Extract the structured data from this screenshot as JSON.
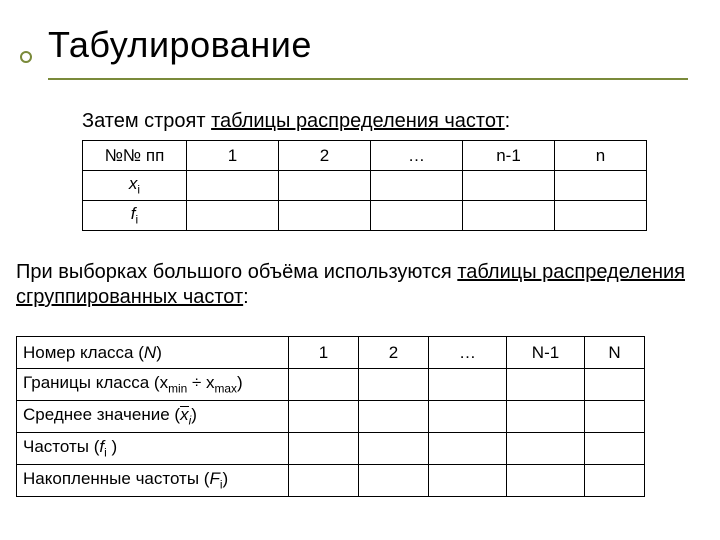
{
  "title": "Табулирование",
  "intro_prefix": "Затем строят ",
  "intro_link": "таблицы распределения частот",
  "intro_suffix": ":",
  "t1": {
    "r0c0": "№№ пп",
    "cols": [
      "1",
      "2",
      "…",
      "n-1",
      "n"
    ],
    "r1_label_var": "x",
    "r1_label_sub": "i",
    "r2_label_var": "f",
    "r2_label_sub": "i"
  },
  "para2_prefix": "При выборках большого объёма используются ",
  "para2_link": "таблицы распределения сгруппированных частот",
  "para2_suffix": ":",
  "t2": {
    "cols": [
      "1",
      "2",
      "…",
      "N-1",
      "N"
    ],
    "r0_prefix": "Номер класса (",
    "r0_var": "N",
    "r0_suffix": ")",
    "r1_prefix": "Границы класса (x",
    "r1_sub1": "min",
    "r1_mid": " ÷ x",
    "r1_sub2": "max",
    "r1_suffix": ")",
    "r2_prefix": "Среднее значение (",
    "r2_xbar": "x",
    "r2_sub": "i",
    "r2_suffix": ")",
    "r3_prefix": "Частоты  (",
    "r3_var": "f",
    "r3_sub": "i",
    "r3_suffix": " )",
    "r4_prefix": "Накопленные частоты (",
    "r4_var": "F",
    "r4_sub": "i",
    "r4_suffix": ")"
  }
}
